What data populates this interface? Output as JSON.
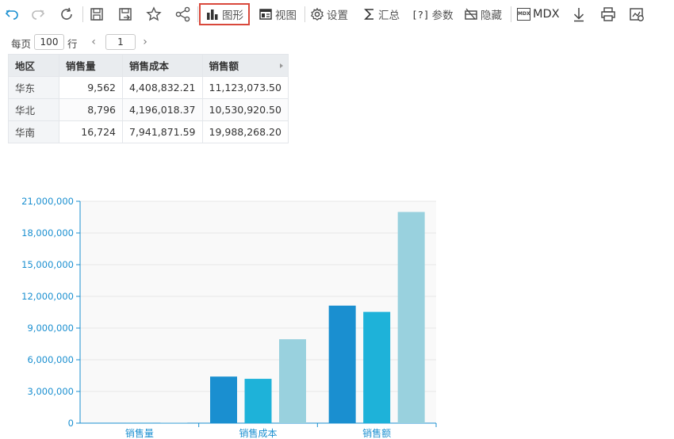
{
  "toolbar": {
    "chart_label": "图形",
    "view_label": "视图",
    "settings_label": "设置",
    "summary_label": "汇总",
    "params_label": "参数",
    "params_icon_text": "[?]",
    "hide_label": "隐藏",
    "mdx_label": "MDX",
    "mdx_icon_text": "MDX"
  },
  "pager": {
    "per_page_label": "每页",
    "per_page_value": "100",
    "rows_label": "行",
    "page_value": "1"
  },
  "table": {
    "headers": [
      "地区",
      "销售量",
      "销售成本",
      "销售额"
    ],
    "rows": [
      [
        "华东",
        "9,562",
        "4,408,832.21",
        "11,123,073.50"
      ],
      [
        "华北",
        "8,796",
        "4,196,018.37",
        "10,530,920.50"
      ],
      [
        "华南",
        "16,724",
        "7,941,871.59",
        "19,988,268.20"
      ]
    ]
  },
  "colors": {
    "series": [
      "#1a8fd0",
      "#1eb2d9",
      "#99d1de"
    ],
    "axis": "#1a8fd0",
    "active_border": "#d9483b"
  },
  "chart_data": {
    "type": "bar",
    "categories": [
      "销售量",
      "销售成本",
      "销售额"
    ],
    "series": [
      {
        "values": [
          9562,
          4408832.21,
          11123073.5
        ]
      },
      {
        "values": [
          8796,
          4196018.37,
          10530920.5
        ]
      },
      {
        "values": [
          16724,
          7941871.59,
          19988268.2
        ]
      }
    ],
    "y_ticks": [
      "0",
      "3,000,000",
      "6,000,000",
      "9,000,000",
      "12,000,000",
      "15,000,000",
      "18,000,000",
      "21,000,000"
    ],
    "ylim": [
      0,
      21000000
    ],
    "grid": true,
    "legend": "none"
  }
}
